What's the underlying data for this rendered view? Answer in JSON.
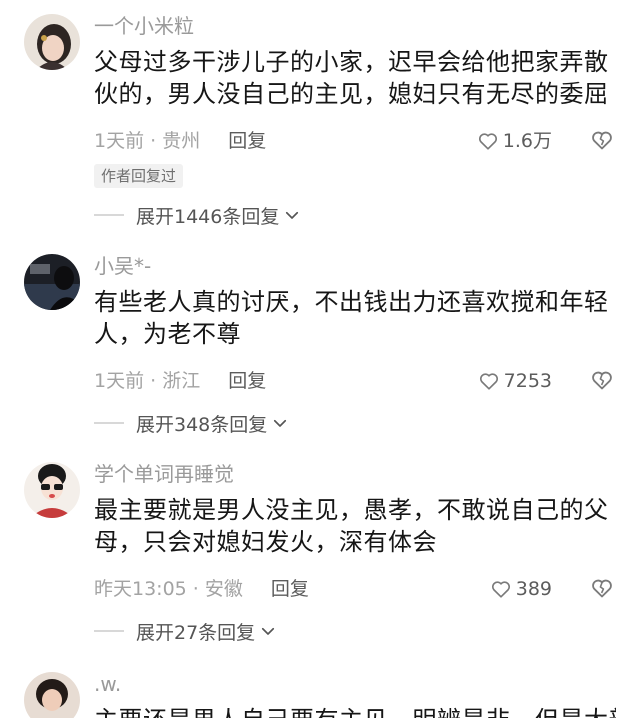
{
  "comments": [
    {
      "username": "一个小米粒",
      "content": "父母过多干涉儿子的小家，迟早会给他把家弄散伙的，男人没自己的主见，媳妇只有无尽的委屈",
      "time_location": "1天前 · 贵州",
      "reply_label": "回复",
      "likes": "1.6万",
      "badge": "作者回复过",
      "expand_label": "展开1446条回复"
    },
    {
      "username": "小吴*-",
      "content": "有些老人真的讨厌，不出钱出力还喜欢搅和年轻人，为老不尊",
      "time_location": "1天前 · 浙江",
      "reply_label": "回复",
      "likes": "7253",
      "expand_label": "展开348条回复"
    },
    {
      "username": "学个单词再睡觉",
      "content": "最主要就是男人没主见，愚孝，不敢说自己的父母，只会对媳妇发火，深有体会",
      "time_location": "昨天13:05 · 安徽",
      "reply_label": "回复",
      "likes": "389",
      "expand_label": "展开27条回复"
    },
    {
      "username": ".w.",
      "content": "主要还是男人自己要有主见，明辨是非，但是大部"
    }
  ],
  "icons": {
    "like": "heart-outline-icon",
    "dislike": "broken-heart-icon",
    "expand": "chevron-down-icon"
  },
  "colors": {
    "username": "#9a9a9a",
    "meta": "#a3a3a3",
    "badge_bg": "#f1f1f1"
  }
}
